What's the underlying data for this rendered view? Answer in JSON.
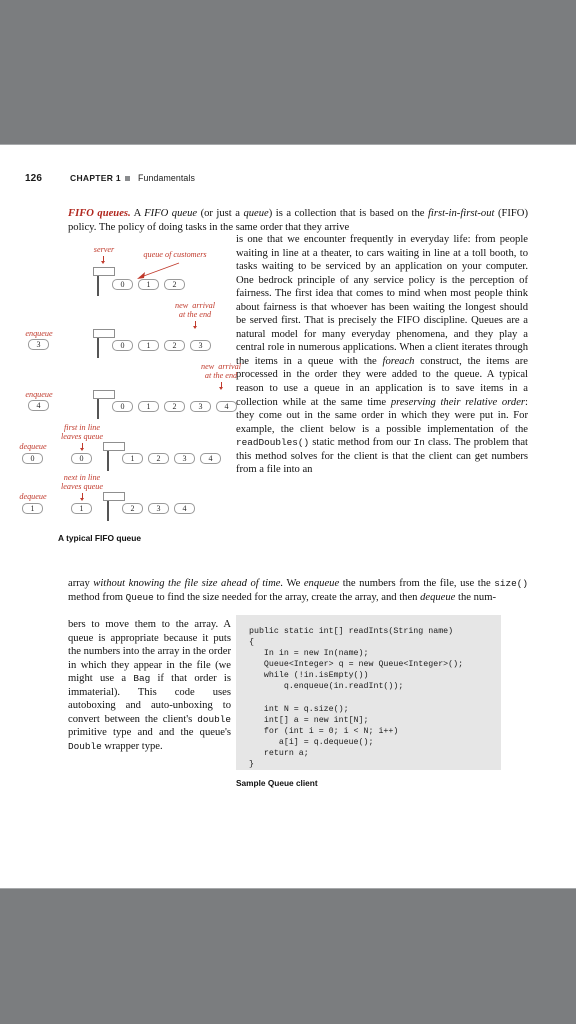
{
  "page": {
    "folio": "126",
    "chapter": "CHAPTER 1",
    "section": "Fundamentals"
  },
  "colors": {
    "accent_red": "#b0271e",
    "figure_red": "#c0392b",
    "code_bg": "#e6e6e6",
    "chrome_gray": "#7b7d7f"
  },
  "body": {
    "lead_in": "FIFO queues.",
    "para_top_html": "  A <i class=\"it\">FIFO queue</i> (or just a <i class=\"it\">queue</i>) is a collection that is based on the <i class=\"it\">first-in-first-out</i> (FIFO) policy. The policy of doing tasks in the same order that they arrive",
    "para_right_html": "is one that we encounter frequently in everyday life: from people waiting in line at a theater, to cars waiting in line at a toll booth, to tasks waiting to be serviced by an application on your computer. One bedrock principle of any service policy is the perception of fairness. The first idea that comes to mind when most people think about fairness is that whoever has been waiting the longest should be served first. That is precisely the FIFO discipline. Queues are a natural model for many everyday phenomena, and they play a central role in numerous applications. When a client iterates through the items in a queue with the <i class=\"it\">foreach</i> construct, the items are processed in the order they were added to the queue. A typical reason to use a queue in an application is to save items in a collection while at the same time <i class=\"it\">preserving their relative order</i>: they come out in the same order in which they were put in. For example, the client below is a possible implementation of the <span class=\"mono\">readDoubles()</span> static method from our <span class=\"mono\">In</span> class. The problem that this method solves for the client is that the client can get numbers from a file into an",
    "para_full_html": "array <i class=\"it\">without knowing the file size ahead of time.</i> We <i class=\"it\">enqueue</i> the numbers from the file, use the <span class=\"mono\">size()</span> method from <span class=\"mono\">Queue</span> to find the size needed for the array, create the array, and then <i class=\"it\">dequeue</i> the num-",
    "para_left_html": "bers to move them to the array. A queue is appropriate because it puts the numbers into the array in the order in which they appear in the file (we might use a <span class=\"mono\">Bag</span> if that order is immaterial). This code uses autoboxing and auto-unboxing to convert between the client's <span class=\"mono\">double</span> primitive type and and the queue's <span class=\"mono\">Double</span> wrapper type."
  },
  "figure": {
    "caption": "A typical FIFO queue",
    "labels": {
      "server": "server",
      "queue_of_customers": "queue of customers",
      "new_arrival_1": "new  arrival\nat the end",
      "new_arrival_2": "new  arrival\nat the end",
      "first_in_line": "first in line\nleaves queue",
      "next_in_line": "next in line\nleaves queue",
      "enqueue_1": "enqueue",
      "enqueue_2": "enqueue",
      "dequeue_1": "dequeue",
      "dequeue_2": "dequeue"
    },
    "rows": [
      {
        "op": "",
        "op_value": "",
        "queue": [
          "0",
          "1",
          "2"
        ]
      },
      {
        "op": "enqueue",
        "op_value": "3",
        "queue": [
          "0",
          "1",
          "2",
          "3"
        ]
      },
      {
        "op": "enqueue",
        "op_value": "4",
        "queue": [
          "0",
          "1",
          "2",
          "3",
          "4"
        ]
      },
      {
        "op": "dequeue",
        "op_value": "0",
        "removed": "0",
        "queue": [
          "1",
          "2",
          "3",
          "4"
        ]
      },
      {
        "op": "dequeue",
        "op_value": "1",
        "removed": "1",
        "queue": [
          "2",
          "3",
          "4"
        ]
      }
    ]
  },
  "code": {
    "caption": "Sample Queue client",
    "text": "public static int[] readInts(String name)\n{\n   In in = new In(name);\n   Queue<Integer> q = new Queue<Integer>();\n   while (!in.isEmpty())\n       q.enqueue(in.readInt());\n\n   int N = q.size();\n   int[] a = new int[N];\n   for (int i = 0; i < N; i++)\n      a[i] = q.dequeue();\n   return a;\n}"
  }
}
